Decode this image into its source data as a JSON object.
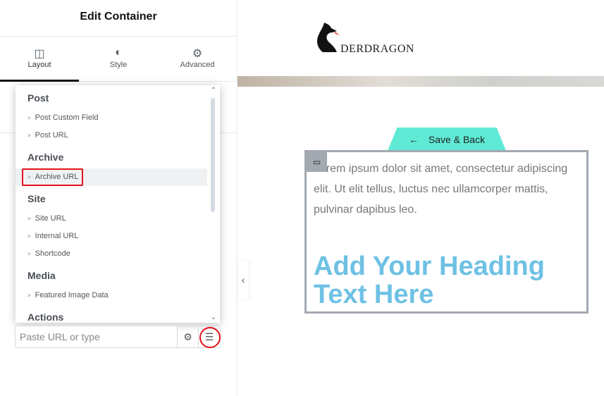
{
  "panel": {
    "title": "Edit Container",
    "tabs": [
      {
        "label": "Layout",
        "icon": "columns-icon"
      },
      {
        "label": "Style",
        "icon": "contrast-icon"
      },
      {
        "label": "Advanced",
        "icon": "gear-icon"
      }
    ]
  },
  "dropdown": {
    "groups": [
      {
        "label": "Post",
        "items": [
          "Post Custom Field",
          "Post URL"
        ]
      },
      {
        "label": "Archive",
        "items": [
          "Archive URL"
        ]
      },
      {
        "label": "Site",
        "items": [
          "Site URL",
          "Internal URL",
          "Shortcode"
        ]
      },
      {
        "label": "Media",
        "items": [
          "Featured Image Data"
        ]
      },
      {
        "label": "Actions",
        "items": []
      }
    ],
    "highlighted": "Archive URL"
  },
  "url_field": {
    "placeholder": "Paste URL or type",
    "value": ""
  },
  "canvas": {
    "logo_text": "DERDRAGON",
    "save_back": "Save & Back",
    "paragraph": "Lorem ipsum dolor sit amet, consectetur adipiscing elit. Ut elit tellus, luctus nec ullamcorper mattis, pulvinar dapibus leo.",
    "heading": "Add Your Heading Text Here"
  },
  "colors": {
    "accent": "#5fead6",
    "heading": "#6ec1e4",
    "highlight": "#e8111b"
  }
}
